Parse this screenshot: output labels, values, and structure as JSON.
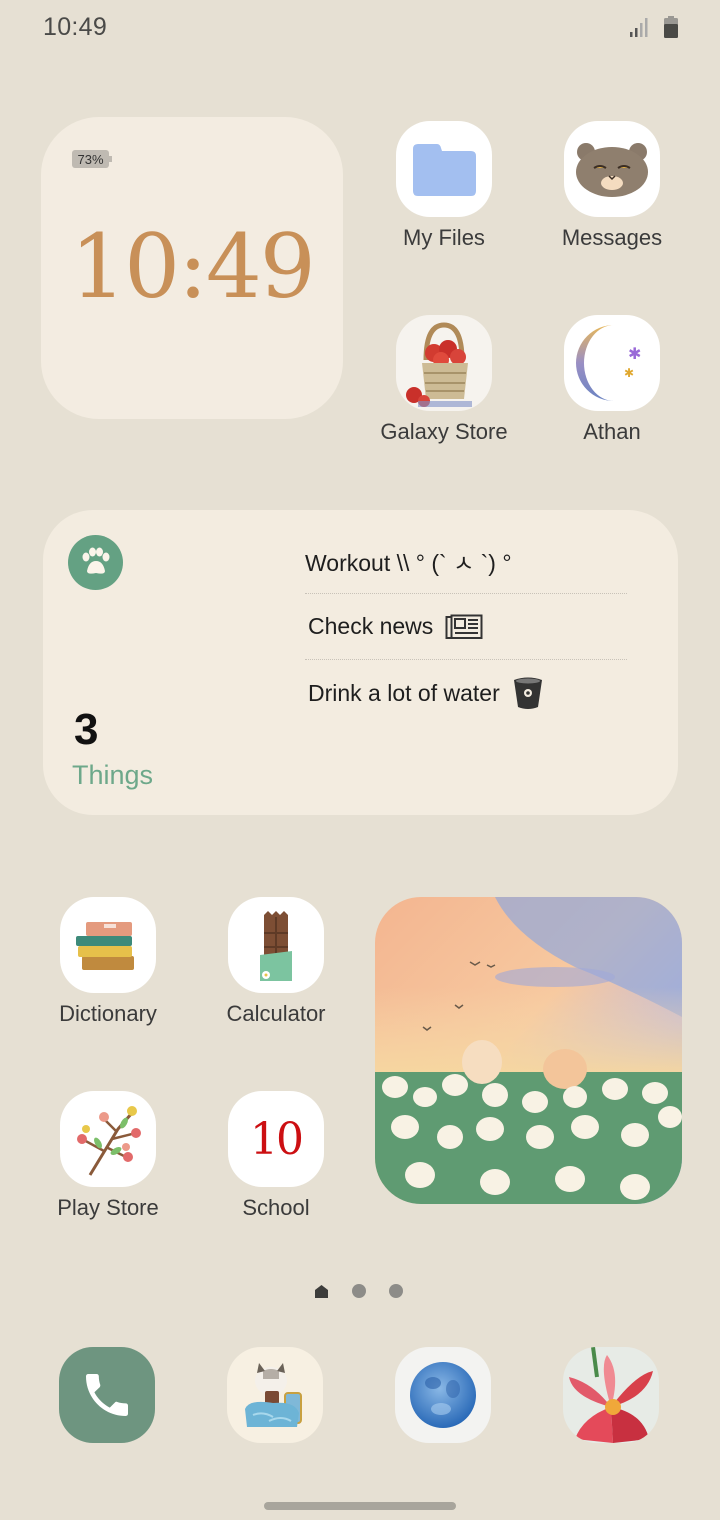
{
  "status_bar": {
    "time": "10:49",
    "signal_icon": "signal-bars-icon",
    "battery_icon": "battery-icon"
  },
  "clock_widget": {
    "battery_percent": "73%",
    "time": "10:49",
    "time_color": "#c89058"
  },
  "apps_top": [
    {
      "label": "My Files",
      "icon": "folder-icon"
    },
    {
      "label": "Messages",
      "icon": "cat-face-icon"
    },
    {
      "label": "Galaxy Store",
      "icon": "strawberry-basket-icon"
    },
    {
      "label": "Athan",
      "icon": "crescent-moon-icon"
    }
  ],
  "todo_widget": {
    "badge_icon": "paw-icon",
    "count": "3",
    "unit": "Things",
    "accent": "#64a183",
    "items": [
      {
        "text": "Workout \\\\ ° (` ㅅ `) °",
        "icon": ""
      },
      {
        "text": "Check news",
        "icon": "newspaper-icon"
      },
      {
        "text": "Drink a lot of water",
        "icon": "water-cup-icon"
      }
    ]
  },
  "apps_bottom": [
    {
      "label": "Dictionary",
      "icon": "books-stack-icon"
    },
    {
      "label": "Calculator",
      "icon": "chocolate-bar-icon"
    },
    {
      "label": "Play Store",
      "icon": "berry-branch-icon"
    },
    {
      "label": "School",
      "icon": "score-ten-icon",
      "glyph": "10"
    }
  ],
  "photo_widget": {
    "description": "tulip field sunset with bunny and bear"
  },
  "page_indicator": {
    "pages": 3,
    "current": 1
  },
  "dock": [
    {
      "name": "Phone",
      "icon": "phone-icon"
    },
    {
      "name": "Cat on bed app",
      "icon": "cat-bed-icon"
    },
    {
      "name": "Blue moon app",
      "icon": "blue-moon-icon"
    },
    {
      "name": "Flower app",
      "icon": "lily-flower-icon"
    }
  ]
}
